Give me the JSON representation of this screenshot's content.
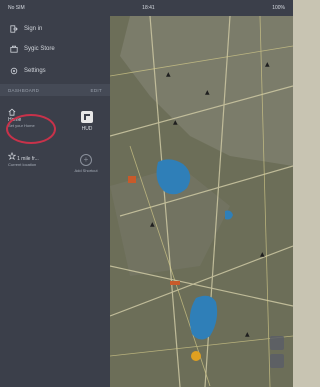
{
  "status": {
    "left": "No SIM",
    "center": "18:41",
    "right": "100%"
  },
  "menu": [
    {
      "label": "Sign in",
      "icon": "exit-icon"
    },
    {
      "label": "Sygic Store",
      "icon": "store-icon"
    },
    {
      "label": "Settings",
      "icon": "gear-icon"
    }
  ],
  "dashboard": {
    "title": "DASHBOARD",
    "edit": "EDIT"
  },
  "tiles": [
    {
      "title": "Home",
      "subtitle": "Set your Home",
      "icon": "home-icon"
    },
    {
      "title": "HUD",
      "subtitle": "",
      "icon": "hud-icon"
    },
    {
      "title": "1 mile fr...",
      "subtitle": "Current location",
      "icon": "star-icon"
    },
    {
      "title": "",
      "subtitle": "Add Shortcut",
      "icon": "plus-icon"
    }
  ],
  "colors": {
    "sidebar": "#3b3f4a",
    "map": "#6a6c57",
    "lake": "#2f7fb8",
    "highlight": "#c8324a"
  }
}
